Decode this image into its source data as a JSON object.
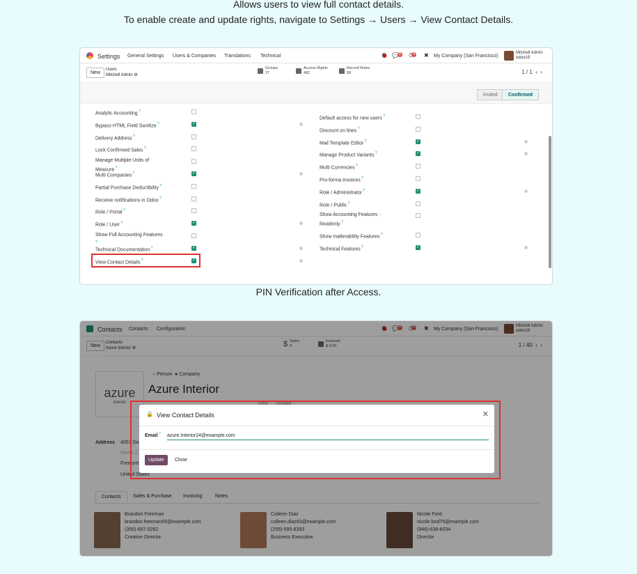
{
  "captions": {
    "line1": "Allows users to view full contact details.",
    "line2": "To enable create and update rights, navigate to Settings → Users → View Contact Details.",
    "line3": "PIN Verification after Access."
  },
  "shot1": {
    "app": "Settings",
    "menu": [
      "General Settings",
      "Users & Companies",
      "Translations",
      "Technical"
    ],
    "badge_msgs": "8",
    "badge_act": "4",
    "company": "My Company (San Francisco)",
    "user": "Mitchell Admin",
    "db": "odoo19",
    "new_btn": "New",
    "bc_parent": "Users",
    "bc_current": "Mitchell Admin",
    "stats": [
      {
        "label": "Groups",
        "value": "27"
      },
      {
        "label": "Access Rights",
        "value": "482"
      },
      {
        "label": "Record Rules",
        "value": "88"
      }
    ],
    "pager": "1 / 1",
    "stages": [
      "Invited",
      "Confirmed"
    ],
    "left_rows": [
      {
        "label": "Analytic Accounting",
        "checked": false
      },
      {
        "label": "Bypass HTML Field Sanitize",
        "checked": true
      },
      {
        "label": "Delivery Address",
        "checked": false
      },
      {
        "label": "Lock Confirmed Sales",
        "checked": false
      },
      {
        "label": "Manage Multiple Units of Measure",
        "checked": false
      },
      {
        "label": "Multi Companies",
        "checked": true
      },
      {
        "label": "Partial Purchase Deductibility",
        "checked": false
      },
      {
        "label": "Receive notifications in Odoo",
        "checked": false
      },
      {
        "label": "Role / Portal",
        "checked": false
      },
      {
        "label": "Role / User",
        "checked": true
      },
      {
        "label": "Show Full Accounting Features",
        "checked": false
      },
      {
        "label": "Technical Documentation",
        "checked": true
      },
      {
        "label": "View Contact Details",
        "checked": true
      }
    ],
    "right_rows": [
      {
        "label": "Default access for new users",
        "checked": false
      },
      {
        "label": "Discount on lines",
        "checked": false
      },
      {
        "label": "Mail Template Editor",
        "checked": true
      },
      {
        "label": "Manage Product Variants",
        "checked": true
      },
      {
        "label": "Multi Currencies",
        "checked": false
      },
      {
        "label": "Pro-forma Invoices",
        "checked": false
      },
      {
        "label": "Role / Administrator",
        "checked": true
      },
      {
        "label": "Role / Public",
        "checked": false
      },
      {
        "label": "Show Accounting Features - Readonly",
        "checked": false
      },
      {
        "label": "Show Inalterability Features",
        "checked": false
      },
      {
        "label": "Technical Features",
        "checked": true
      }
    ]
  },
  "shot2": {
    "app": "Contacts",
    "menu": [
      "Contacts",
      "Configuration"
    ],
    "badge_msgs": "8",
    "badge_act": "4",
    "company": "My Company (San Francisco)",
    "user": "Mitchell Admin",
    "db": "odoo19",
    "new_btn": "New",
    "bc_parent": "Contacts",
    "bc_current": "Azure Interior",
    "stats": [
      {
        "label": "Sales",
        "value": "0"
      },
      {
        "label": "Invoiced",
        "value": "$ 0.00"
      }
    ],
    "pager": "1 / 40",
    "type_person": "Person",
    "type_company": "Company",
    "logo_text": "azure",
    "logo_sub": "interior",
    "name": "Azure Interior",
    "address_label": "Address",
    "address": [
      "4557 De Silva St",
      "Street 2...",
      "Fremont",
      "United States"
    ],
    "header_links": [
      "View",
      "Update"
    ],
    "tabs": [
      "Contacts",
      "Sales & Purchase",
      "Invoicing",
      "Notes"
    ],
    "modal": {
      "title": "View Contact Details",
      "email_label": "Email",
      "email_value": "azure.Interior24@example.com",
      "update": "Update",
      "close": "Close"
    },
    "cards": [
      {
        "name": "Brandon Freeman",
        "email": "brandon.freeman55@example.com",
        "phone": "(355)-687-3262",
        "title": "Creative Director"
      },
      {
        "name": "Colleen Diaz",
        "email": "colleen.diaz83@example.com",
        "phone": "(255)-595-8393",
        "title": "Business Executive"
      },
      {
        "name": "Nicole Ford",
        "email": "nicole.ford75@example.com",
        "phone": "(946)-638-6034",
        "title": "Director"
      }
    ]
  }
}
